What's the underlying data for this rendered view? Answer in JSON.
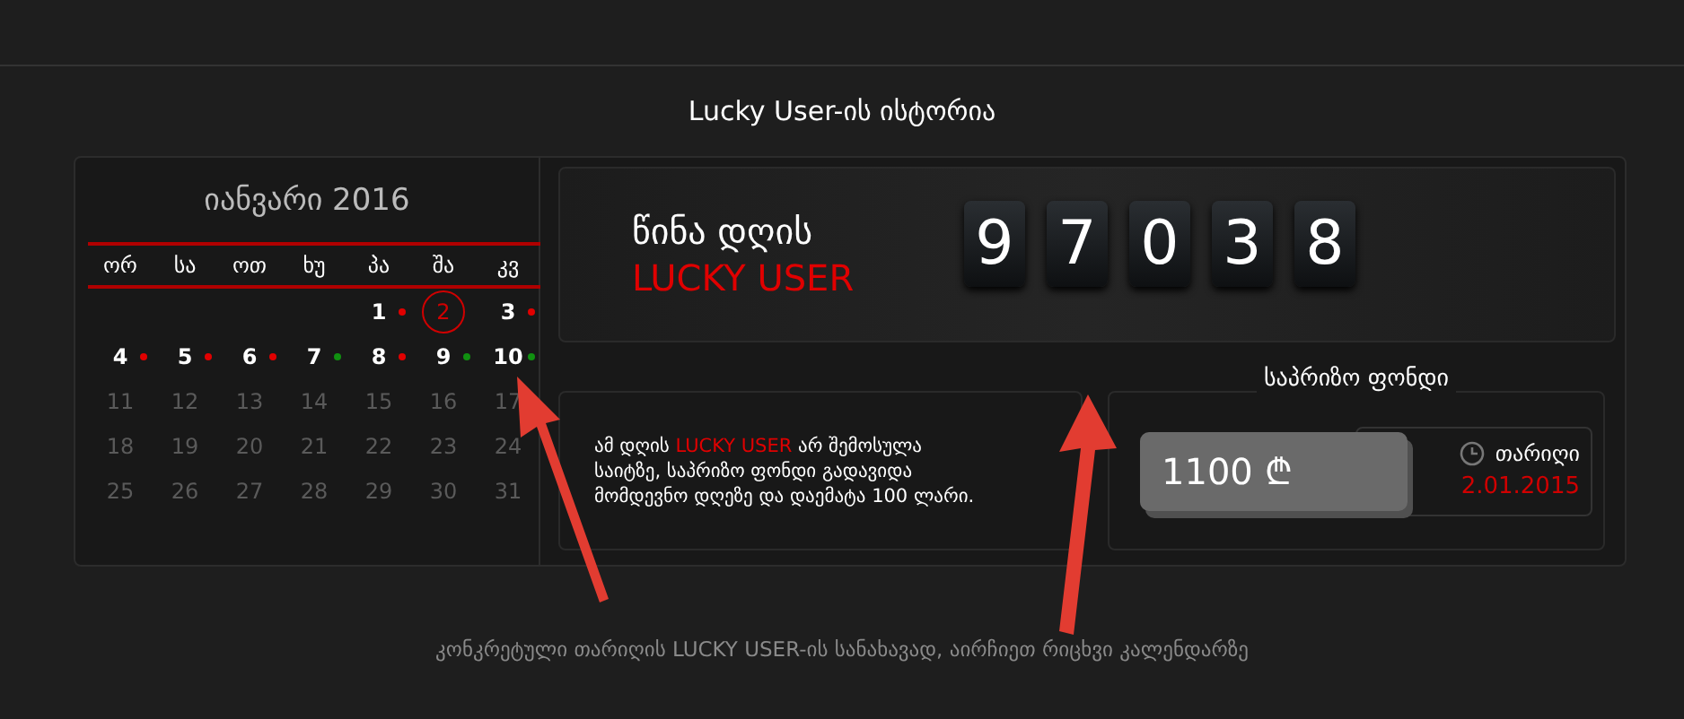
{
  "title": "Lucky User-ის ისტორია",
  "calendar": {
    "month": "იანვარი 2016",
    "weekdays": [
      "ორ",
      "სა",
      "ოთ",
      "ხუ",
      "პა",
      "შა",
      "კვ"
    ],
    "days": [
      {
        "day": "1",
        "color": "#e00000",
        "selected": false,
        "disabled": false
      },
      {
        "day": "2",
        "selected": true,
        "disabled": false
      },
      {
        "day": "3",
        "color": "#e00000",
        "selected": false,
        "disabled": false
      },
      {
        "day": "4",
        "color": "#e00000",
        "selected": false,
        "disabled": false
      },
      {
        "day": "5",
        "color": "#e00000",
        "selected": false,
        "disabled": false
      },
      {
        "day": "6",
        "color": "#e00000",
        "selected": false,
        "disabled": false
      },
      {
        "day": "7",
        "color": "#109010",
        "selected": false,
        "disabled": false
      },
      {
        "day": "8",
        "color": "#e00000",
        "selected": false,
        "disabled": false
      },
      {
        "day": "9",
        "color": "#109010",
        "selected": false,
        "disabled": false
      },
      {
        "day": "10",
        "color": "#109010",
        "selected": false,
        "disabled": false
      },
      {
        "day": "11",
        "selected": false,
        "disabled": true
      },
      {
        "day": "12",
        "selected": false,
        "disabled": true
      },
      {
        "day": "13",
        "selected": false,
        "disabled": true
      },
      {
        "day": "14",
        "selected": false,
        "disabled": true
      },
      {
        "day": "15",
        "selected": false,
        "disabled": true
      },
      {
        "day": "16",
        "selected": false,
        "disabled": true
      },
      {
        "day": "17",
        "selected": false,
        "disabled": true
      },
      {
        "day": "18",
        "selected": false,
        "disabled": true
      },
      {
        "day": "19",
        "selected": false,
        "disabled": true
      },
      {
        "day": "20",
        "selected": false,
        "disabled": true
      },
      {
        "day": "21",
        "selected": false,
        "disabled": true
      },
      {
        "day": "22",
        "selected": false,
        "disabled": true
      },
      {
        "day": "23",
        "selected": false,
        "disabled": true
      },
      {
        "day": "24",
        "selected": false,
        "disabled": true
      },
      {
        "day": "25",
        "selected": false,
        "disabled": true
      },
      {
        "day": "26",
        "selected": false,
        "disabled": true
      },
      {
        "day": "27",
        "selected": false,
        "disabled": true
      },
      {
        "day": "28",
        "selected": false,
        "disabled": true
      },
      {
        "day": "29",
        "selected": false,
        "disabled": true
      },
      {
        "day": "30",
        "selected": false,
        "disabled": true
      },
      {
        "day": "31",
        "selected": false,
        "disabled": true
      }
    ]
  },
  "winner": {
    "heading": "წინა დღის",
    "highlight": "LUCKY USER",
    "digits": [
      "9",
      "7",
      "0",
      "3",
      "8"
    ]
  },
  "message": {
    "prefix": "ამ დღის",
    "highlight": "LUCKY USER",
    "rest": "არ შემოსულა საიტზე, საპრიზო ფონდი გადავიდა მომდევნო დღეზე და დაემატა 100 ლარი."
  },
  "prize": {
    "title": "საპრიზო ფონდი",
    "amount": "1100 ₾",
    "date_label": "თარიღი",
    "date": "2.01.2015"
  },
  "footer": "კონკრეტული თარიღის LUCKY USER-ის სანახავად, აირჩიეთ რიცხვი კალენდარზე"
}
